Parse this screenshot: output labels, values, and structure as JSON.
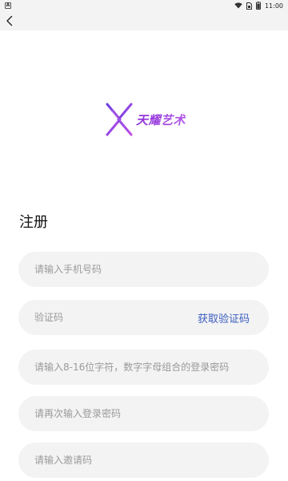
{
  "status_bar": {
    "app_badge": "A",
    "time": "11:00",
    "icons": [
      "wifi-icon",
      "sim-icon",
      "battery-icon"
    ]
  },
  "top_bar": {
    "back_icon": "chevron-left-icon"
  },
  "logo": {
    "text": "天耀艺术",
    "colors": [
      "#8c2fd8",
      "#b25be8"
    ]
  },
  "page_title": "注册",
  "form": {
    "phone_placeholder": "请输入手机号码",
    "code_placeholder": "验证码",
    "get_code_label": "获取验证码",
    "password_placeholder": "请输入8-16位字符，数字字母组合的登录密码",
    "confirm_password_placeholder": "请再次输入登录密码",
    "invite_code_placeholder": "请输入邀请码"
  },
  "colors": {
    "accent_link": "#3c5fbf",
    "field_background": "#f3f3f4",
    "placeholder": "#9a9a9a"
  }
}
